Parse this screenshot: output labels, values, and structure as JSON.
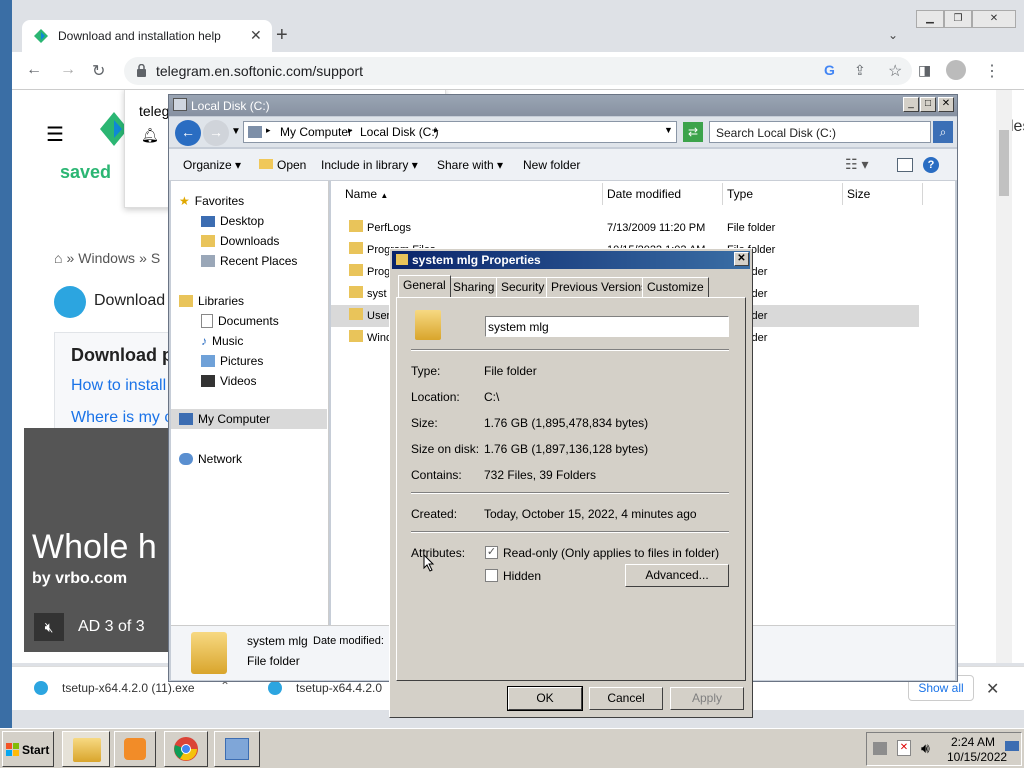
{
  "chrome": {
    "tab_title": "Download and installation help",
    "url": "telegram.en.softonic.com/support",
    "page": {
      "saved": "saved",
      "tele": "teleg",
      "breadcrumb_windows": "Windows",
      "breadcrumb_sep": "»",
      "breadcrumb_s": "S",
      "download_heading": "Download",
      "box_title": "Download p",
      "link1": "How to install",
      "link2": "Where is my c",
      "articles": "cles",
      "ad_title": "Whole h",
      "ad_sub": "by vrbo.com",
      "ad_counter": "AD 3 of 3"
    },
    "downloads": [
      {
        "name": "tsetup-x64.4.2.0 (11).exe"
      },
      {
        "name": "tsetup-x64.4.2.0"
      }
    ],
    "show_all": "Show all"
  },
  "explorer": {
    "title": "Local Disk (C:)",
    "breadcrumb": [
      "My Computer",
      "Local Disk (C:)"
    ],
    "search_placeholder": "Search Local Disk (C:)",
    "commands": {
      "organize": "Organize",
      "open": "Open",
      "include": "Include in library",
      "share": "Share with",
      "new_folder": "New folder"
    },
    "nav": {
      "favorites": "Favorites",
      "desktop": "Desktop",
      "downloads": "Downloads",
      "recent": "Recent Places",
      "libraries": "Libraries",
      "documents": "Documents",
      "music": "Music",
      "pictures": "Pictures",
      "videos": "Videos",
      "computer": "My Computer",
      "network": "Network"
    },
    "columns": {
      "name": "Name",
      "date": "Date modified",
      "type": "Type",
      "size": "Size"
    },
    "files": [
      {
        "name": "PerfLogs",
        "date": "7/13/2009 11:20 PM",
        "type": "File folder"
      },
      {
        "name": "Program Files",
        "date": "10/15/2022 1:02 AM",
        "type": "File folder"
      },
      {
        "name": "Prog",
        "date": "",
        "type": "older"
      },
      {
        "name": "syst",
        "date": "",
        "type": "older"
      },
      {
        "name": "User",
        "date": "",
        "type": "older"
      },
      {
        "name": "Wind",
        "date": "",
        "type": "older"
      }
    ],
    "details": {
      "name": "system mlg",
      "date_label": "Date modified:",
      "type": "File folder"
    }
  },
  "props": {
    "title": "system mlg Properties",
    "tabs": [
      "General",
      "Sharing",
      "Security",
      "Previous Versions",
      "Customize"
    ],
    "name": "system mlg",
    "labels": {
      "type": "Type:",
      "location": "Location:",
      "size": "Size:",
      "size_on_disk": "Size on disk:",
      "contains": "Contains:",
      "created": "Created:",
      "attributes": "Attributes:"
    },
    "values": {
      "type": "File folder",
      "location": "C:\\",
      "size": "1.76 GB (1,895,478,834 bytes)",
      "size_on_disk": "1.76 GB (1,897,136,128 bytes)",
      "contains": "732 Files, 39 Folders",
      "created": "Today, October 15, 2022, 4 minutes ago"
    },
    "readonly": "Read-only (Only applies to files in folder)",
    "hidden": "Hidden",
    "advanced": "Advanced...",
    "ok": "OK",
    "cancel": "Cancel",
    "apply": "Apply"
  },
  "taskbar": {
    "start": "Start",
    "time": "2:24 AM",
    "date": "10/15/2022"
  },
  "colors": {
    "accent": "#0a246a",
    "chrome_blue": "#1a73e8",
    "desktop": "#3a6ea5"
  }
}
